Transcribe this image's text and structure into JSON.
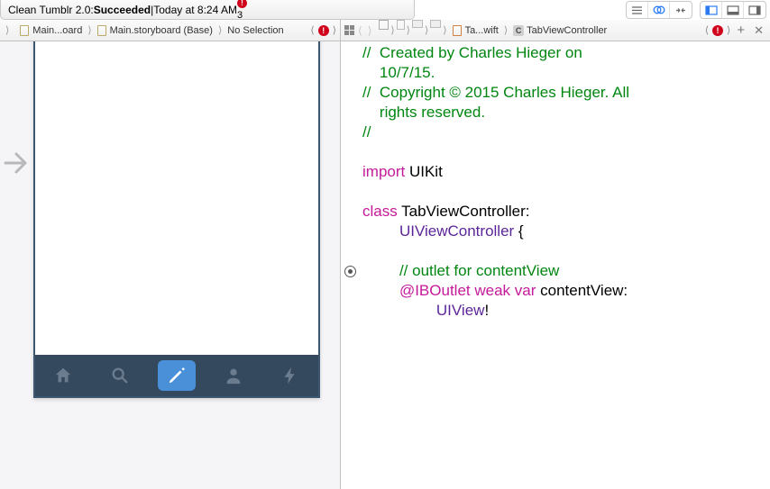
{
  "status": {
    "title_prefix": "Clean Tumblr 2.0: ",
    "title_status": "Succeeded",
    "timestamp": "Today at 8:24 AM",
    "error_glyph": "!",
    "error_count": "3"
  },
  "jumpbar_left": {
    "item1": "Main...oard",
    "item2": "Main.storyboard (Base)",
    "item3": "No Selection"
  },
  "jumpbar_right": {
    "tab1": "Ta...wift",
    "tab2": "TabViewController",
    "tab2_badge": "C"
  },
  "code": {
    "l1a": "//  ",
    "l1b": "Created by Charles Hieger on",
    "l2": "10/7/15.",
    "l3a": "//  ",
    "l3b": "Copyright © 2015 Charles Hieger. All",
    "l4": "rights reserved.",
    "l5": "//",
    "blank": "",
    "l7_import": "import",
    "l7_uikit": " UIKit",
    "l9_class": "class",
    "l9_name": " TabViewController:",
    "l10_name": "UIViewController",
    "l10_brace": " {",
    "l12": "// outlet for contentView",
    "l13_ib": "@IBOutlet",
    "l13_weak": " weak",
    "l13_var": " var",
    "l13_name": " contentView:",
    "l14_type": "UIView",
    "l14_bang": "!"
  }
}
